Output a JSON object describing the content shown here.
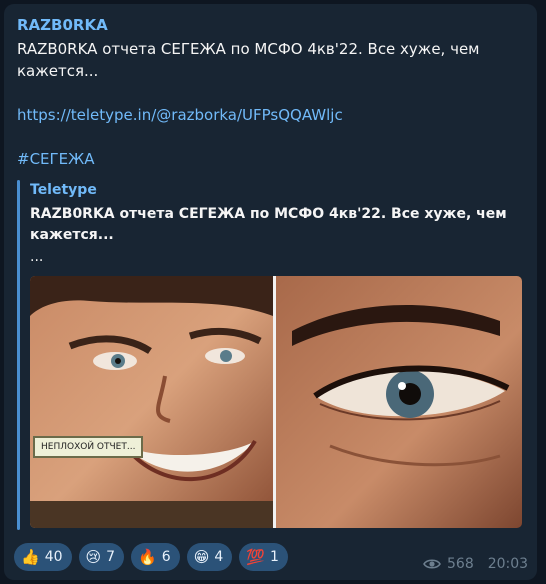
{
  "post": {
    "channel_name": "RAZB0RKA",
    "text_line1": "RAZB0RKA отчета СЕГЕЖА по МСФО 4кв'22. Все хуже, чем",
    "text_line2": "кажется...",
    "link": "https://teletype.in/@razborka/UFPsQQAWljc",
    "hashtag": "#СЕГЕЖА"
  },
  "preview": {
    "site_name": "Teletype",
    "title_line1": "RAZB0RKA отчета СЕГЕЖА по МСФО 4кв'22. Все хуже, чем",
    "title_line2": "кажется...",
    "description": "...",
    "image_caption": "НЕПЛОХОЙ ОТЧЕТ..."
  },
  "reactions": [
    {
      "emoji": "👍",
      "count": "40"
    },
    {
      "emoji": "😢",
      "count": "7"
    },
    {
      "emoji": "🔥",
      "count": "6"
    },
    {
      "emoji": "😁",
      "count": "4"
    },
    {
      "emoji": "💯",
      "count": "1"
    }
  ],
  "meta": {
    "views": "568",
    "time": "20:03"
  },
  "colors": {
    "background": "#0e1621",
    "bubble": "#182533",
    "accent": "#71baf9",
    "reaction_bg": "#2b5278"
  }
}
